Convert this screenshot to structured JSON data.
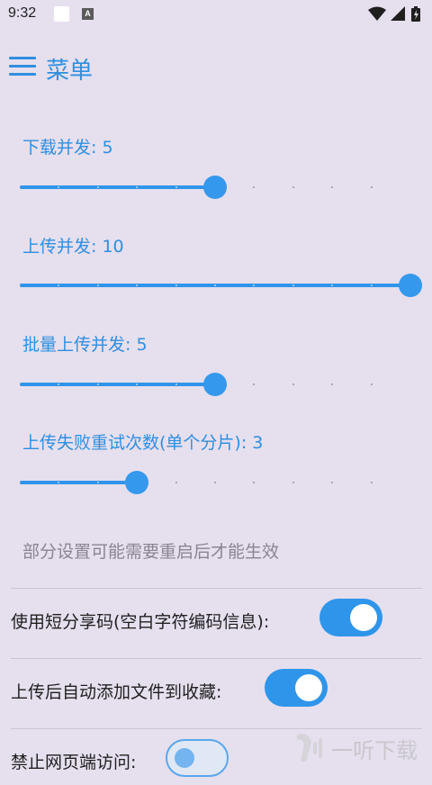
{
  "status_bar": {
    "time": "9:32",
    "notif_icon_letter": "A"
  },
  "app_bar": {
    "title": "菜单",
    "menu_icon": "hamburger-menu-icon"
  },
  "sliders": [
    {
      "label": "下载并发: 5",
      "value": 5,
      "min": 0,
      "max": 10
    },
    {
      "label": "上传并发: 10",
      "value": 10,
      "min": 0,
      "max": 10
    },
    {
      "label": "批量上传并发: 5",
      "value": 5,
      "min": 0,
      "max": 10
    },
    {
      "label": "上传失败重试次数(单个分片): 3",
      "value": 3,
      "min": 0,
      "max": 10
    }
  ],
  "note": "部分设置可能需要重启后才能生效",
  "toggles": [
    {
      "label": "使用短分享码(空白字符编码信息):",
      "on": true
    },
    {
      "label": "上传后自动添加文件到收藏:",
      "on": true
    },
    {
      "label": "禁止网页端访问:",
      "on": false
    }
  ],
  "watermark": {
    "text": "一听下载",
    "logo_icon": "listen-logo-icon"
  },
  "colors": {
    "accent": "#2f95ea",
    "background": "#e6dfee",
    "tick_dim": "#9a95a0",
    "tick_active": "#b9daf6"
  }
}
